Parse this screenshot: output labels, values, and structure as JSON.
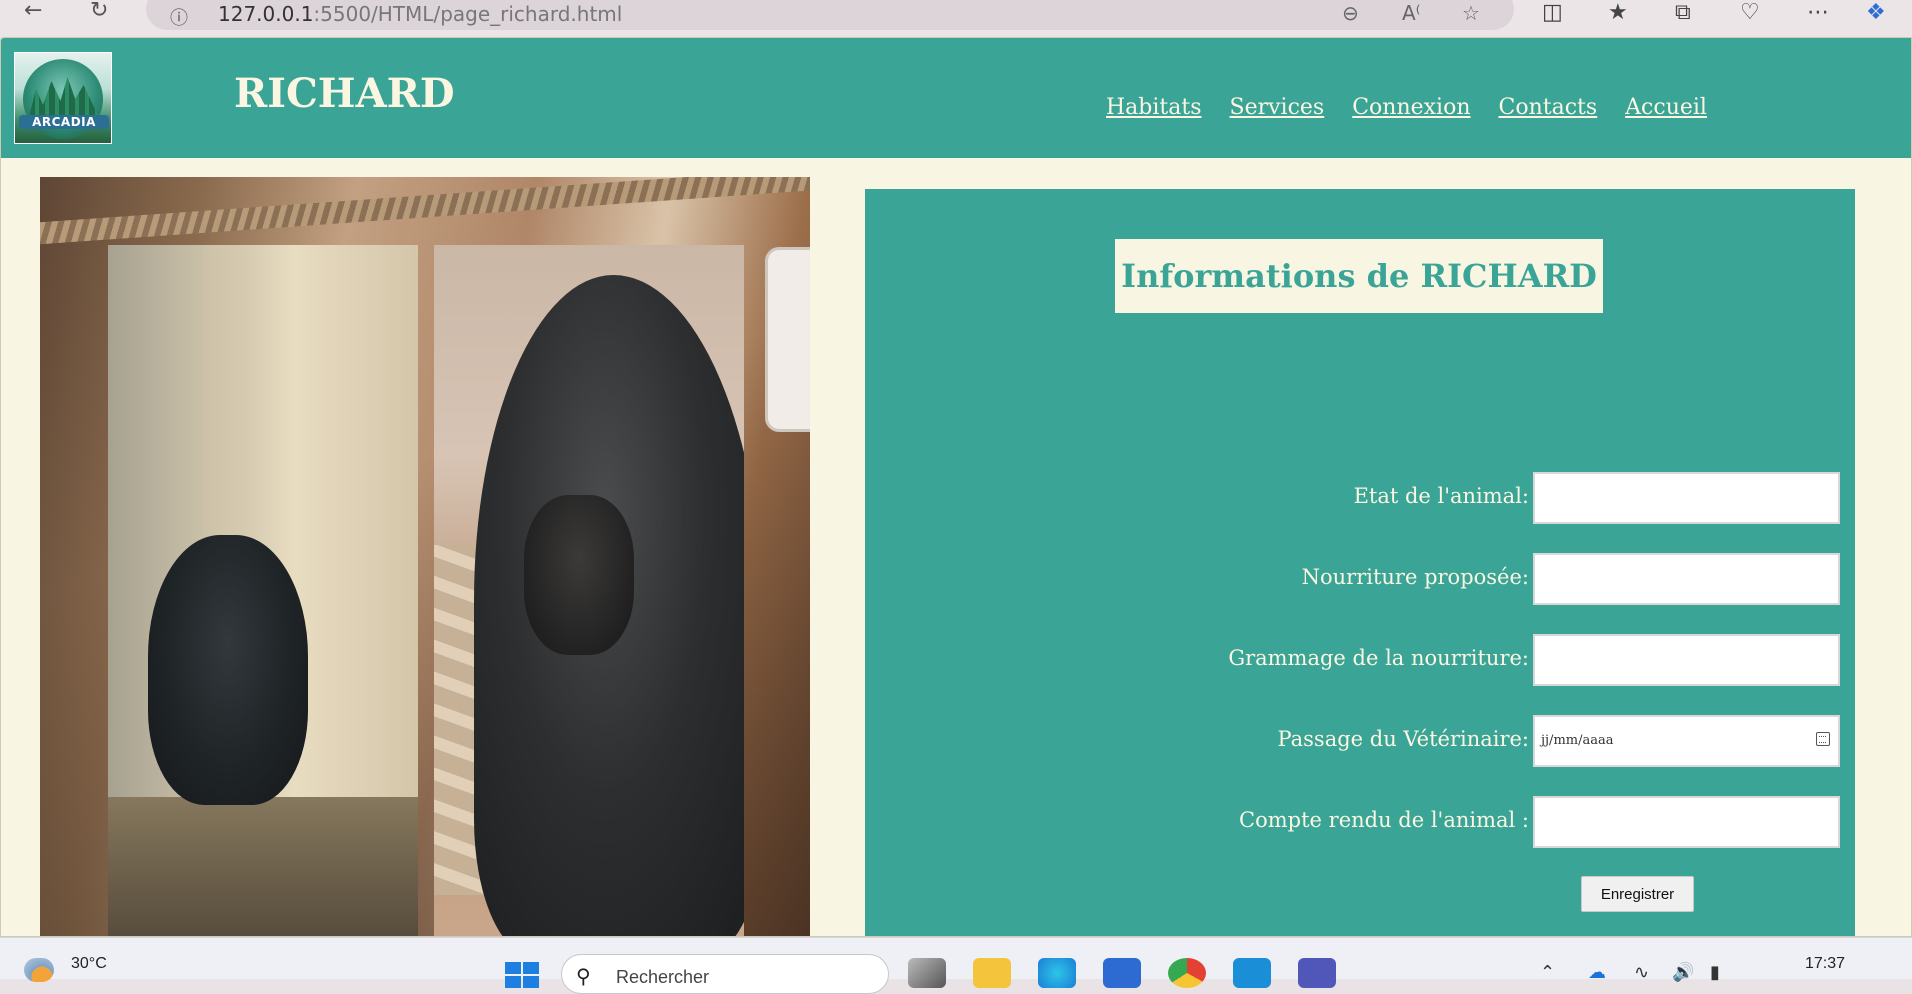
{
  "browser": {
    "back_icon": "arrow-left",
    "reload_icon": "reload",
    "info_icon": "info-circle",
    "url_host": "127.0.0.1",
    "url_rest": ":5500/HTML/page_richard.html"
  },
  "header": {
    "logo_text": "ARCADIA",
    "title": "RICHARD",
    "nav": [
      {
        "label": "Habitats"
      },
      {
        "label": "Services"
      },
      {
        "label": "Connexion"
      },
      {
        "label": "Contacts"
      },
      {
        "label": "Accueil"
      }
    ]
  },
  "panel": {
    "title": "Informations de RICHARD",
    "fields": [
      {
        "label": "Etat de l'animal:",
        "value": ""
      },
      {
        "label": "Nourriture proposée:",
        "value": ""
      },
      {
        "label": "Grammage de la nourriture:",
        "value": ""
      },
      {
        "label": "Passage du Vétérinaire:",
        "placeholder": "jj/mm/aaaa"
      },
      {
        "label": "Compte rendu de l'animal :",
        "value": ""
      }
    ],
    "submit_label": "Enregistrer"
  },
  "taskbar": {
    "temperature": "30°C",
    "search_placeholder": "Rechercher",
    "time": "17:37"
  },
  "colors": {
    "teal": "#3aa597",
    "cream": "#f8f5e2"
  }
}
